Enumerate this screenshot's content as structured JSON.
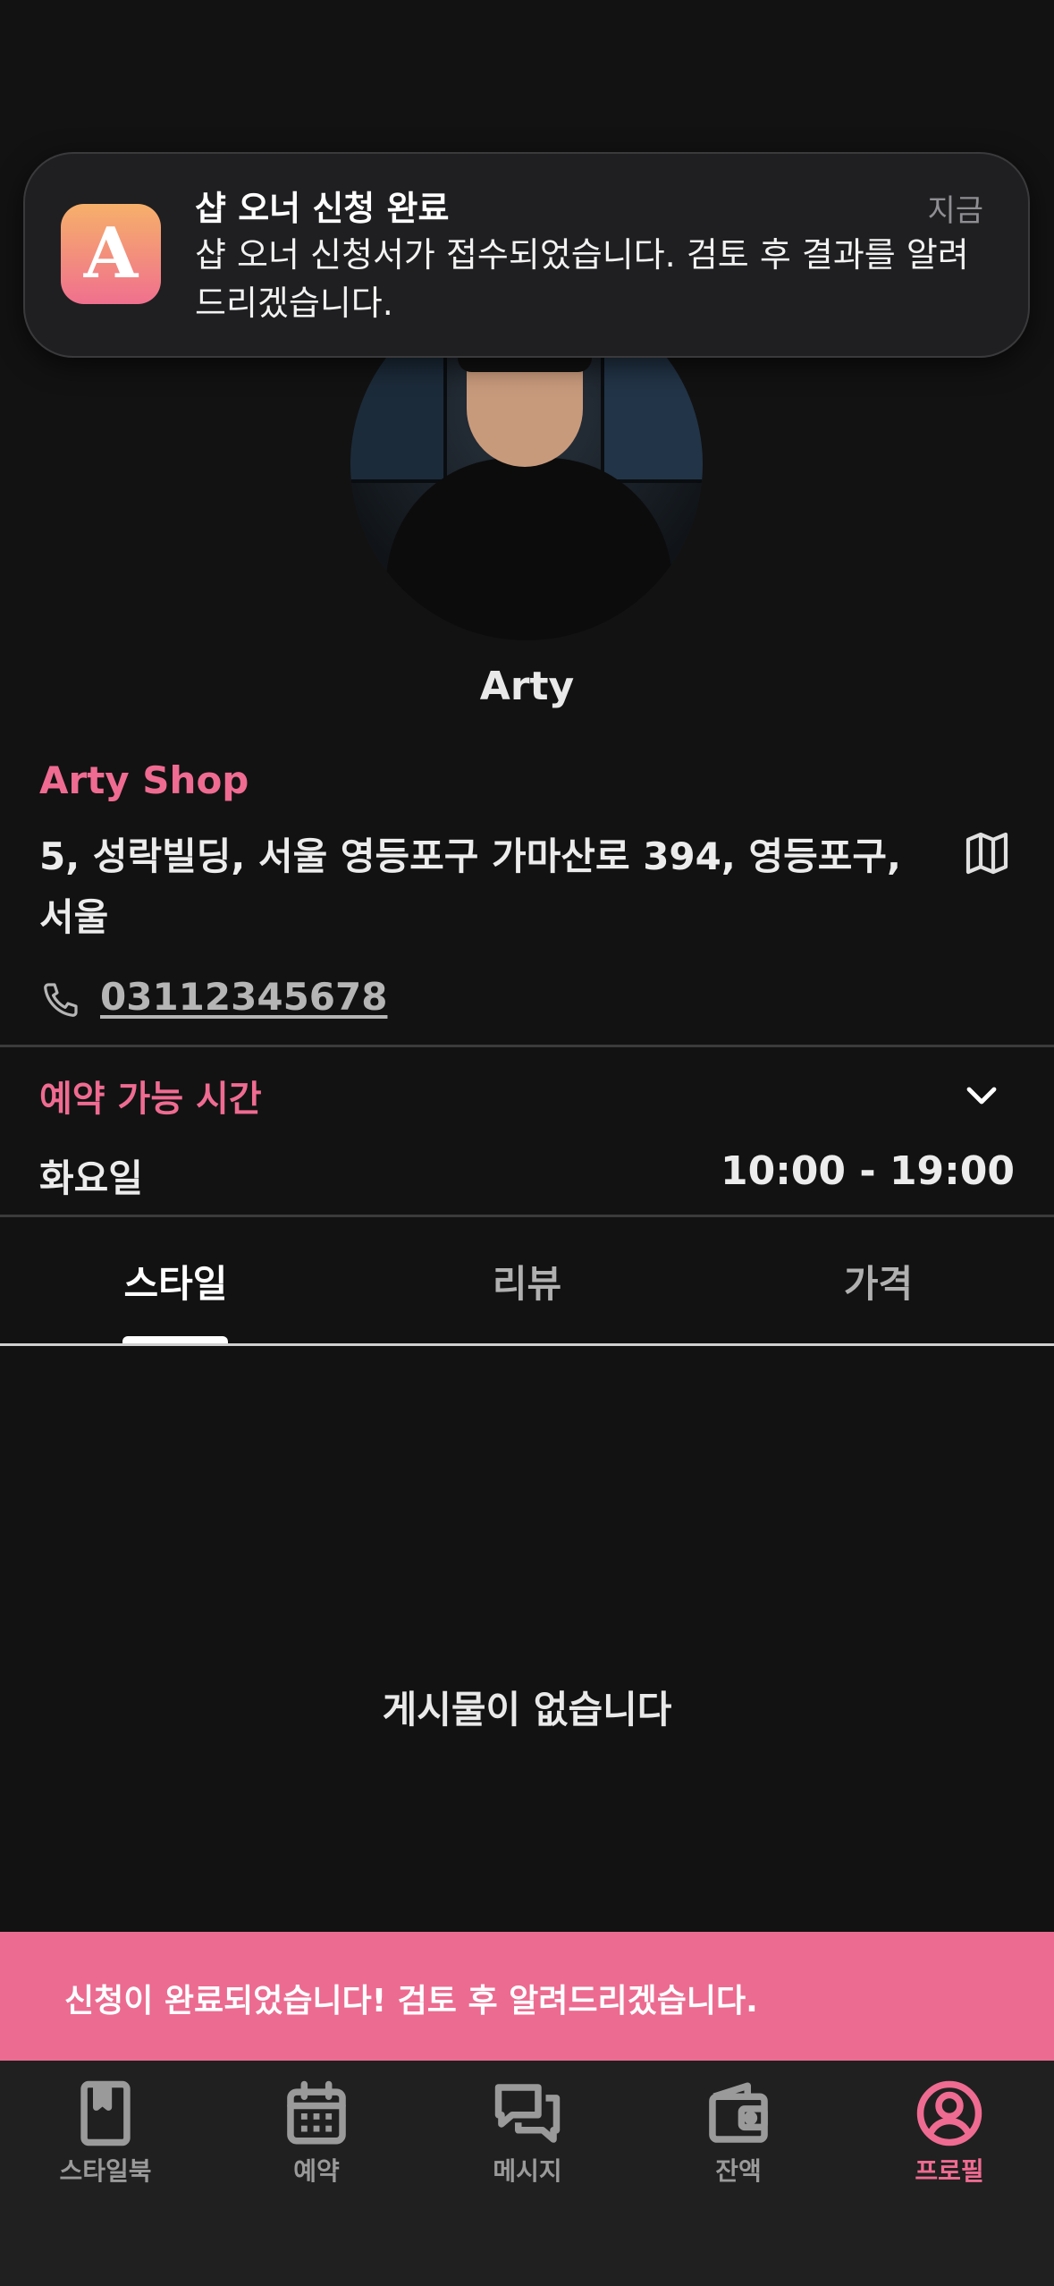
{
  "notification": {
    "title": "샵 오너 신청 완료",
    "time": "지금",
    "body": "샵 오너 신청서가 접수되었습니다. 검토 후 결과를 알려드리겠습니다.",
    "app_icon_letter": "A"
  },
  "profile": {
    "name": "Arty"
  },
  "shop": {
    "name": "Arty Shop",
    "address": "5, 성락빌딩, 서울 영등포구 가마산로 394, 영등포구, 서울",
    "phone": "03112345678"
  },
  "hours": {
    "title": "예약 가능 시간",
    "day": "화요일",
    "time": "10:00 - 19:00"
  },
  "tabs": [
    {
      "label": "스타일",
      "active": true
    },
    {
      "label": "리뷰",
      "active": false
    },
    {
      "label": "가격",
      "active": false
    }
  ],
  "empty_message": "게시물이 없습니다",
  "toast": "신청이 완료되었습니다! 검토 후 알려드리겠습니다.",
  "nav": [
    {
      "label": "스타일북",
      "icon": "bookmark-book-icon",
      "active": false
    },
    {
      "label": "예약",
      "icon": "calendar-icon",
      "active": false
    },
    {
      "label": "메시지",
      "icon": "chat-bubbles-icon",
      "active": false
    },
    {
      "label": "잔액",
      "icon": "wallet-icon",
      "active": false
    },
    {
      "label": "프로필",
      "icon": "profile-icon",
      "active": true
    }
  ],
  "colors": {
    "accent": "#ef6b91",
    "background": "#121212",
    "nav_background": "#202020",
    "inactive_icon": "#9a9a9a"
  }
}
